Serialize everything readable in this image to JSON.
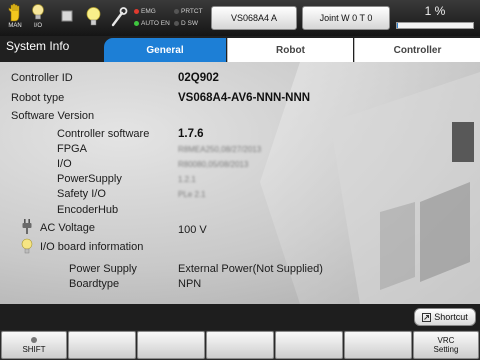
{
  "statusbar": {
    "icons": [
      {
        "name": "hand-icon",
        "caption": "MAN"
      },
      {
        "name": "lightbulb-icon",
        "caption": "I/O"
      },
      {
        "name": "stop-square-icon",
        "caption": ""
      },
      {
        "name": "lightbulb-icon",
        "caption": ""
      },
      {
        "name": "wrench-icon",
        "caption": ""
      }
    ],
    "indicators": {
      "emg": {
        "label": "EMG",
        "color": "#e03a2e"
      },
      "auto_en": {
        "label": "AUTO EN",
        "color": "#3fc63f"
      },
      "prtct": {
        "label": "PRTCT",
        "color": "#555555"
      },
      "dsw": {
        "label": "D SW",
        "color": "#555555"
      }
    },
    "robot_button": "VS068A4 A",
    "joint_button": "Joint  W 0 T 0",
    "progress_text": "1 %",
    "progress_value": 0.01
  },
  "header": {
    "title": "System Info",
    "tabs": [
      "General",
      "Robot",
      "Controller"
    ],
    "active_tab": "General"
  },
  "general": {
    "controller_id_label": "Controller ID",
    "controller_id": "02Q902",
    "robot_type_label": "Robot type",
    "robot_type": "VS068A4-AV6-NNN-NNN",
    "software_version_label": "Software Version",
    "controller_software_label": "Controller software",
    "controller_software": "1.7.6",
    "fpga_label": "FPGA",
    "fpga": "R8MEA250,08/27/2013",
    "io_label": "I/O",
    "io": "R80080,05/08/2013",
    "power_supply_label": "PowerSupply",
    "power_supply": "1.2.1",
    "safety_io_label": "Safety I/O",
    "safety_io": "PLe 2.1",
    "encoder_hub_label": "EncoderHub",
    "ac_voltage_label": "AC Voltage",
    "ac_voltage": "100 V",
    "io_board_label": "I/O board information",
    "board_power_supply_label": "Power Supply",
    "board_power_supply": "External Power(Not Supplied)",
    "boardtype_label": "Boardtype",
    "boardtype": "NPN"
  },
  "footer": {
    "shortcut_label": "Shortcut",
    "shift_label": "SHIFT",
    "vrc_label_line1": "VRC",
    "vrc_label_line2": "Setting"
  },
  "colors": {
    "accent": "#1d7fd6",
    "tab_bar": "#202020"
  }
}
